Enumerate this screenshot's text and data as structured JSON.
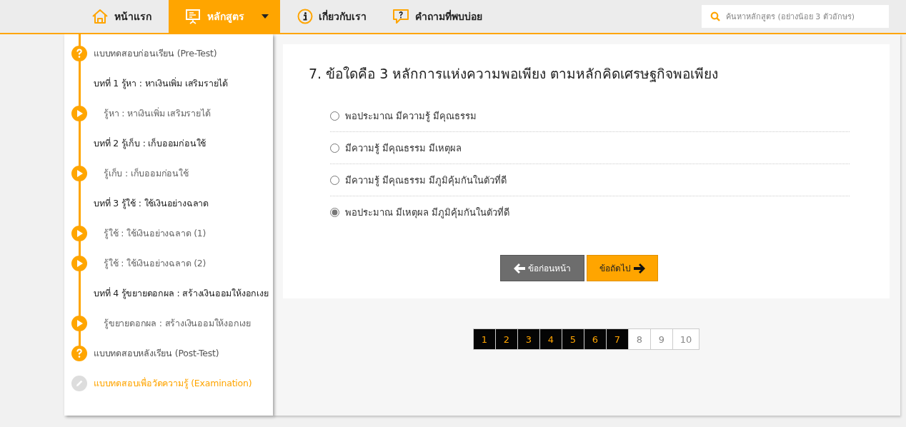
{
  "nav": {
    "items": [
      {
        "label": "หน้าแรก",
        "selected": false,
        "dropdown": false
      },
      {
        "label": "หลักสูตร",
        "selected": true,
        "dropdown": true
      },
      {
        "label": "เกี่ยวกับเรา",
        "selected": false,
        "dropdown": false
      },
      {
        "label": "คำถามที่พบบ่อย",
        "selected": false,
        "dropdown": false
      }
    ],
    "search": {
      "placeholder": "ค้นหาหลักสูตร (อย่างน้อย 3 ตัวอักษร)"
    }
  },
  "sidebar": {
    "items": [
      {
        "kind": "test",
        "label": "แบบทดสอบก่อนเรียน (Pre-Test)",
        "active": false
      },
      {
        "kind": "chapter",
        "label": "บทที่ 1 รู้หา : หาเงินเพิ่ม เสริมรายได้",
        "active": false
      },
      {
        "kind": "lesson",
        "label": "รู้หา : หาเงินเพิ่ม เสริมรายได้",
        "active": false
      },
      {
        "kind": "chapter",
        "label": "บทที่ 2 รู้เก็บ : เก็บออมก่อนใช้",
        "active": false
      },
      {
        "kind": "lesson",
        "label": "รู้เก็บ : เก็บออมก่อนใช้",
        "active": false
      },
      {
        "kind": "chapter",
        "label": "บทที่ 3 รู้ใช้ : ใช้เงินอย่างฉลาด",
        "active": false
      },
      {
        "kind": "lesson",
        "label": "รู้ใช้ : ใช้เงินอย่างฉลาด (1)",
        "active": false
      },
      {
        "kind": "lesson",
        "label": "รู้ใช้ : ใช้เงินอย่างฉลาด (2)",
        "active": false
      },
      {
        "kind": "chapter",
        "label": "บทที่ 4 รู้ขยายดอกผล : สร้างเงินออมให้งอกเงย",
        "active": false
      },
      {
        "kind": "lesson",
        "label": "รู้ขยายดอกผล : สร้างเงินออมให้งอกเงย",
        "active": false
      },
      {
        "kind": "test",
        "label": "แบบทดสอบหลังเรียน (Post-Test)",
        "active": false
      },
      {
        "kind": "exam",
        "label": "แบบทดสอบเพื่อวัดความรู้ (Examination)",
        "active": true
      }
    ]
  },
  "quiz": {
    "question": "7. ข้อใดคือ 3 หลักการแห่งความพอเพียง ตามหลักคิดเศรษฐกิจพอเพียง",
    "options": [
      {
        "label": "พอประมาณ มีความรู้ มีคุณธรรม",
        "selected": false
      },
      {
        "label": "มีความรู้ มีคุณธรรม มีเหตุผล",
        "selected": false
      },
      {
        "label": "มีความรู้ มีคุณธรรม มีภูมิคุ้มกันในตัวที่ดี",
        "selected": false
      },
      {
        "label": "พอประมาณ มีเหตุผล มีภูมิคุ้มกันในตัวที่ดี",
        "selected": true
      }
    ],
    "prev_button": "ข้อก่อนหน้า",
    "next_button": "ข้อถัดไป"
  },
  "pagination": [
    {
      "label": "1",
      "answered": true
    },
    {
      "label": "2",
      "answered": true
    },
    {
      "label": "3",
      "answered": true
    },
    {
      "label": "4",
      "answered": true
    },
    {
      "label": "5",
      "answered": true
    },
    {
      "label": "6",
      "answered": true
    },
    {
      "label": "7",
      "answered": true
    },
    {
      "label": "8",
      "answered": false
    },
    {
      "label": "9",
      "answered": false
    },
    {
      "label": "10",
      "answered": false
    }
  ]
}
